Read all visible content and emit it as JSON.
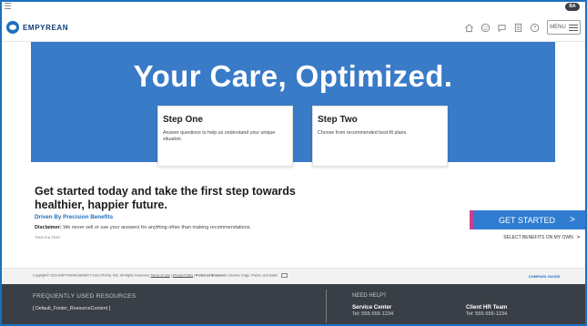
{
  "topbar": {
    "user_initials": "BA"
  },
  "header": {
    "brand": "EMPYREAN",
    "icons": [
      "home-icon",
      "smiley-icon",
      "chat-icon",
      "document-icon",
      "help-icon"
    ],
    "menu_label": "MENU"
  },
  "hero": {
    "title": "Your Care, Optimized."
  },
  "steps": [
    {
      "title": "Step One",
      "text": "Answer questions to help us understand your unique situation."
    },
    {
      "title": "Step Two",
      "text": "Choose from recommended best-fit plans."
    }
  ],
  "intro": {
    "heading": "Get started today and take the first step towards healthier, happier future.",
    "driven_by": "Driven By Precision Benefits",
    "disclaimer_label": "Disclaimer:",
    "disclaimer_text": "We never sell or use your answers for anything other than making recommendations.",
    "test_note": "THIS IS A TEST"
  },
  "actions": {
    "get_started": "GET STARTED",
    "get_started_arrow": ">",
    "select_own": "SELECT BENEFITS ON MY OWN",
    "select_own_arrow": ">"
  },
  "copyright": {
    "text": "Copyright© 2023 EMPYREAN BENEFIT SOLUTIONS, INC. All Rights Reserved.",
    "terms": "Terms of Use",
    "privacy": "Privacy Policy",
    "browsers_label": "Preferred Browsers:",
    "browsers": "Chrome, Edge, Firefox, and Safari",
    "brandmark": "COMPASS 202305"
  },
  "footer": {
    "resources_heading": "FREQUENTLY USED RESOURCES",
    "resources_content": "[ Default_Footer_ResourceContent ]",
    "help_heading": "NEED HELP?",
    "service_center": "Service Center",
    "service_tel": "Tel: 555-555-1234",
    "client_hr": "Client HR Team",
    "client_tel": "Tel: 555-555-1234"
  },
  "colors": {
    "page_border": "#1e6fbf",
    "hero": "#3a7bc8",
    "cta": "#2f7cd1",
    "cta_accent": "#c9408e",
    "footer": "#3a3f47"
  }
}
